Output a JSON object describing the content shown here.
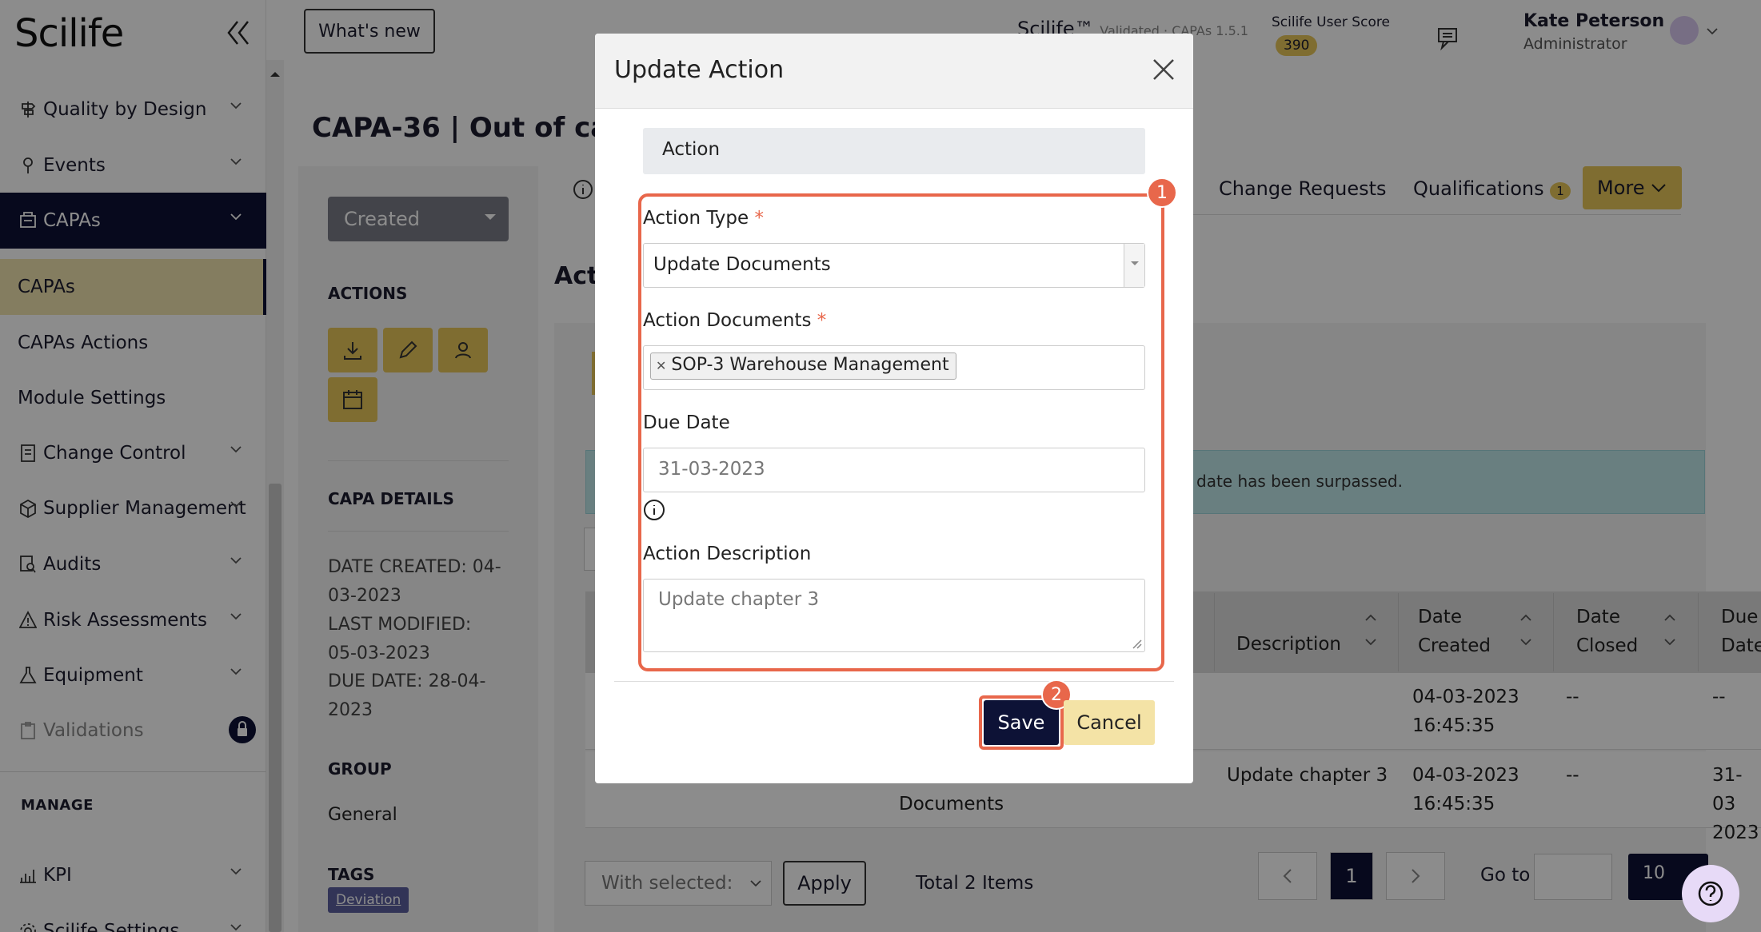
{
  "app": {
    "logo": "Scilife"
  },
  "sidebar": {
    "items": [
      {
        "label": "Quality by Design"
      },
      {
        "label": "Events"
      },
      {
        "label": "CAPAs"
      },
      {
        "label": "CAPAs"
      },
      {
        "label": "CAPAs Actions"
      },
      {
        "label": "Module Settings"
      },
      {
        "label": "Change Control"
      },
      {
        "label": "Supplier Management"
      },
      {
        "label": "Audits"
      },
      {
        "label": "Risk Assessments"
      },
      {
        "label": "Equipment"
      },
      {
        "label": "Validations"
      },
      {
        "label": "KPI"
      },
      {
        "label": "Scilife Settings"
      }
    ],
    "manage_heading": "MANAGE"
  },
  "header": {
    "whats_new": "What's new",
    "brand": "Scilife™",
    "brand_sub": "Validated · CAPAs 1.5.1",
    "score_label": "Scilife User Score",
    "score": "390",
    "user_name": "Kate Peterson",
    "user_role": "Administrator"
  },
  "page": {
    "title": "CAPA-36  |  Out of ca",
    "status": "Created",
    "actions_heading": "ACTIONS",
    "details_heading": "CAPA DETAILS",
    "date_created": "DATE CREATED: 04-03-2023",
    "last_modified": "LAST MODIFIED: 05-03-2023",
    "due_date": "DUE DATE: 28-04-2023",
    "group_heading": "GROUP",
    "group": "General",
    "tags_heading": "TAGS",
    "tag": "Deviation",
    "section_title": "Act",
    "tabs": {
      "change_requests": "Change Requests",
      "qualifications": "Qualifications",
      "qualifications_count": "1",
      "more": "More"
    },
    "alert_text": "date has been surpassed."
  },
  "table": {
    "headers": {
      "description": "Description",
      "date_created": "Date Created",
      "date_closed": "Date Closed",
      "due_date": "Due Date"
    },
    "rows": [
      {
        "description": "",
        "date_created": "04-03-2023 16:45:35",
        "date_closed": "--",
        "due_date": "--",
        "type_tail": ""
      },
      {
        "description": "Update chapter 3",
        "date_created": "04-03-2023 16:45:35",
        "date_closed": "--",
        "due_date": "31-03 2023",
        "type_tail": "Documents"
      }
    ],
    "with_selected": "With selected:",
    "apply": "Apply",
    "total": "Total 2 Items",
    "current_page": "1",
    "go_to": "Go to",
    "page_size": "10"
  },
  "modal": {
    "title": "Update Action",
    "section": "Action",
    "action_type_label": "Action Type",
    "action_type_value": "Update Documents",
    "action_documents_label": "Action Documents",
    "document_chip": "SOP-3 Warehouse Management",
    "due_date_label": "Due Date",
    "due_date_placeholder": "31-03-2023",
    "description_label": "Action Description",
    "description_placeholder": "Update chapter 3",
    "save": "Save",
    "cancel": "Cancel",
    "step1": "1",
    "step2": "2",
    "required_mark": "*"
  },
  "colors": {
    "navy": "#0d1236",
    "gold": "#e8c65a",
    "highlight": "#e8674b"
  }
}
